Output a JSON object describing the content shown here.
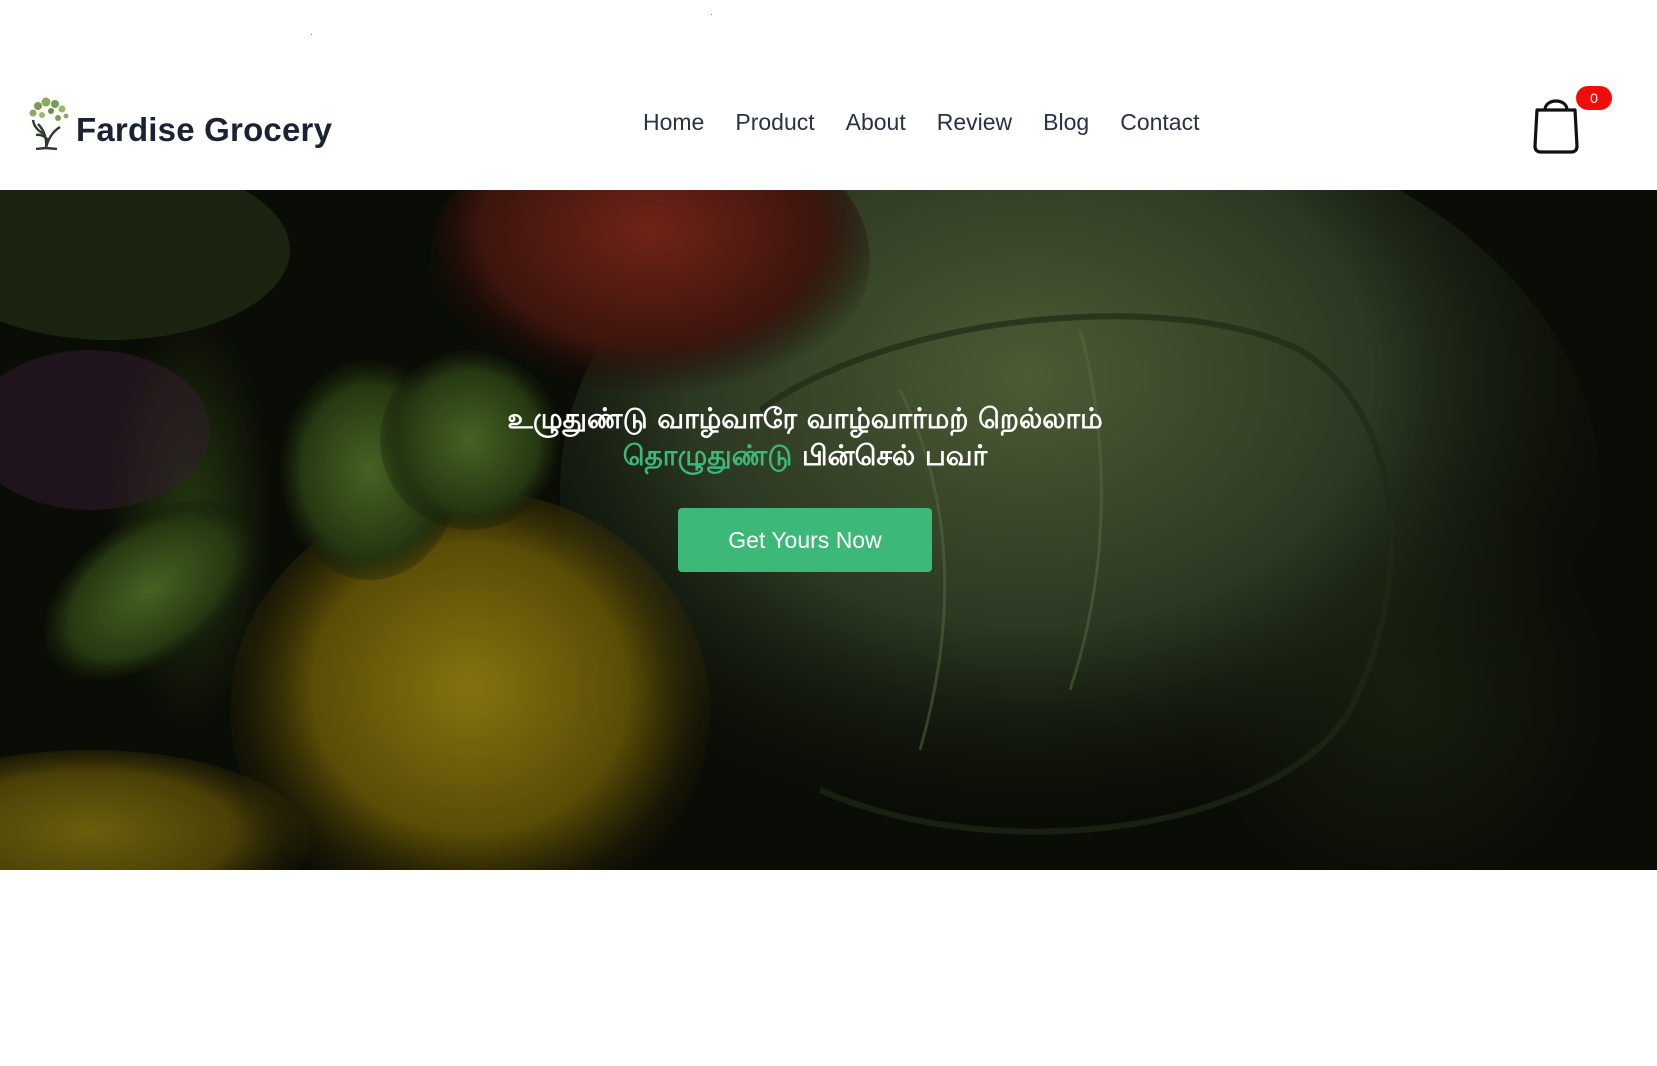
{
  "brand": {
    "name": "Fardise Grocery"
  },
  "nav": {
    "items": [
      "Home",
      "Product",
      "About",
      "Review",
      "Blog",
      "Contact"
    ]
  },
  "cart": {
    "count": "0",
    "icon": "shopping-bag-icon"
  },
  "hero": {
    "line1": "உழுதுண்டு வாழ்வாரே வாழ்வார்மற் றெல்லாம்",
    "line2_accent": "தொழுதுண்டு",
    "line2_rest": " பின்செல் பவர்",
    "cta_label": "Get Yours Now"
  },
  "colors": {
    "accent": "#3cb878",
    "badge": "#f20d0d",
    "text": "#1b2233"
  }
}
